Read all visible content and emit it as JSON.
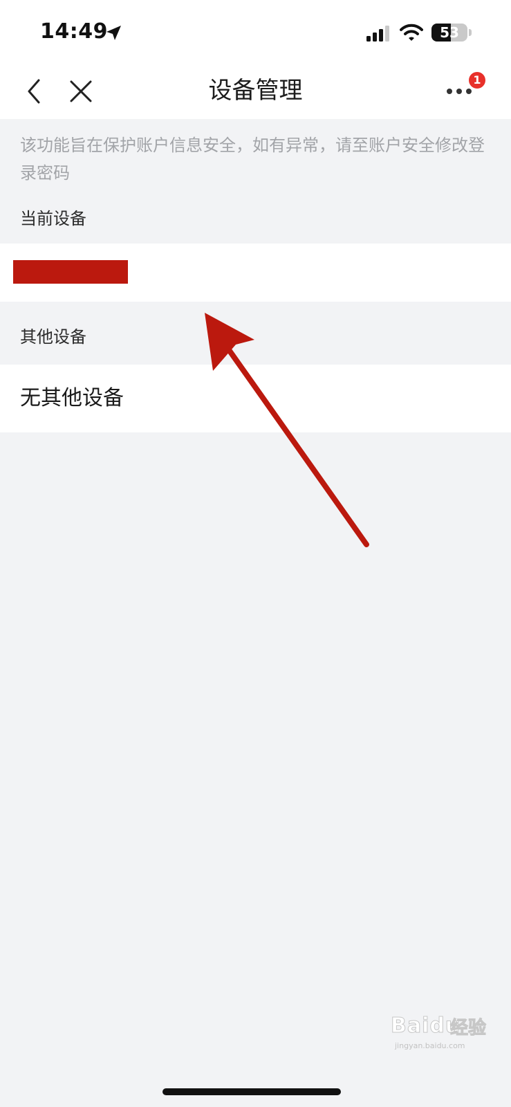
{
  "status_bar": {
    "time": "14:49",
    "battery_level": "53",
    "icons": [
      "location-arrow-icon",
      "cellular-signal-icon",
      "wifi-icon",
      "battery-icon"
    ]
  },
  "nav": {
    "title": "设备管理",
    "back_icon": "chevron-left-icon",
    "close_icon": "close-icon",
    "more_icon": "more-dots-icon",
    "more_badge": "1"
  },
  "notice": "该功能旨在保护账户信息安全，如有异常，请至账户安全修改登录密码",
  "sections": {
    "current": {
      "label": "当前设备"
    },
    "other": {
      "label": "其他设备",
      "empty_text": "无其他设备"
    }
  },
  "annotation": {
    "color": "#bb190e",
    "icon": "arrow-annotation-icon"
  },
  "watermark": {
    "logo": "Baidu",
    "suffix": "经验",
    "url": "jingyan.baidu.com"
  },
  "colors": {
    "background": "#f2f3f5",
    "card": "#ffffff",
    "badge": "#e8302a",
    "redaction": "#bb190e"
  }
}
